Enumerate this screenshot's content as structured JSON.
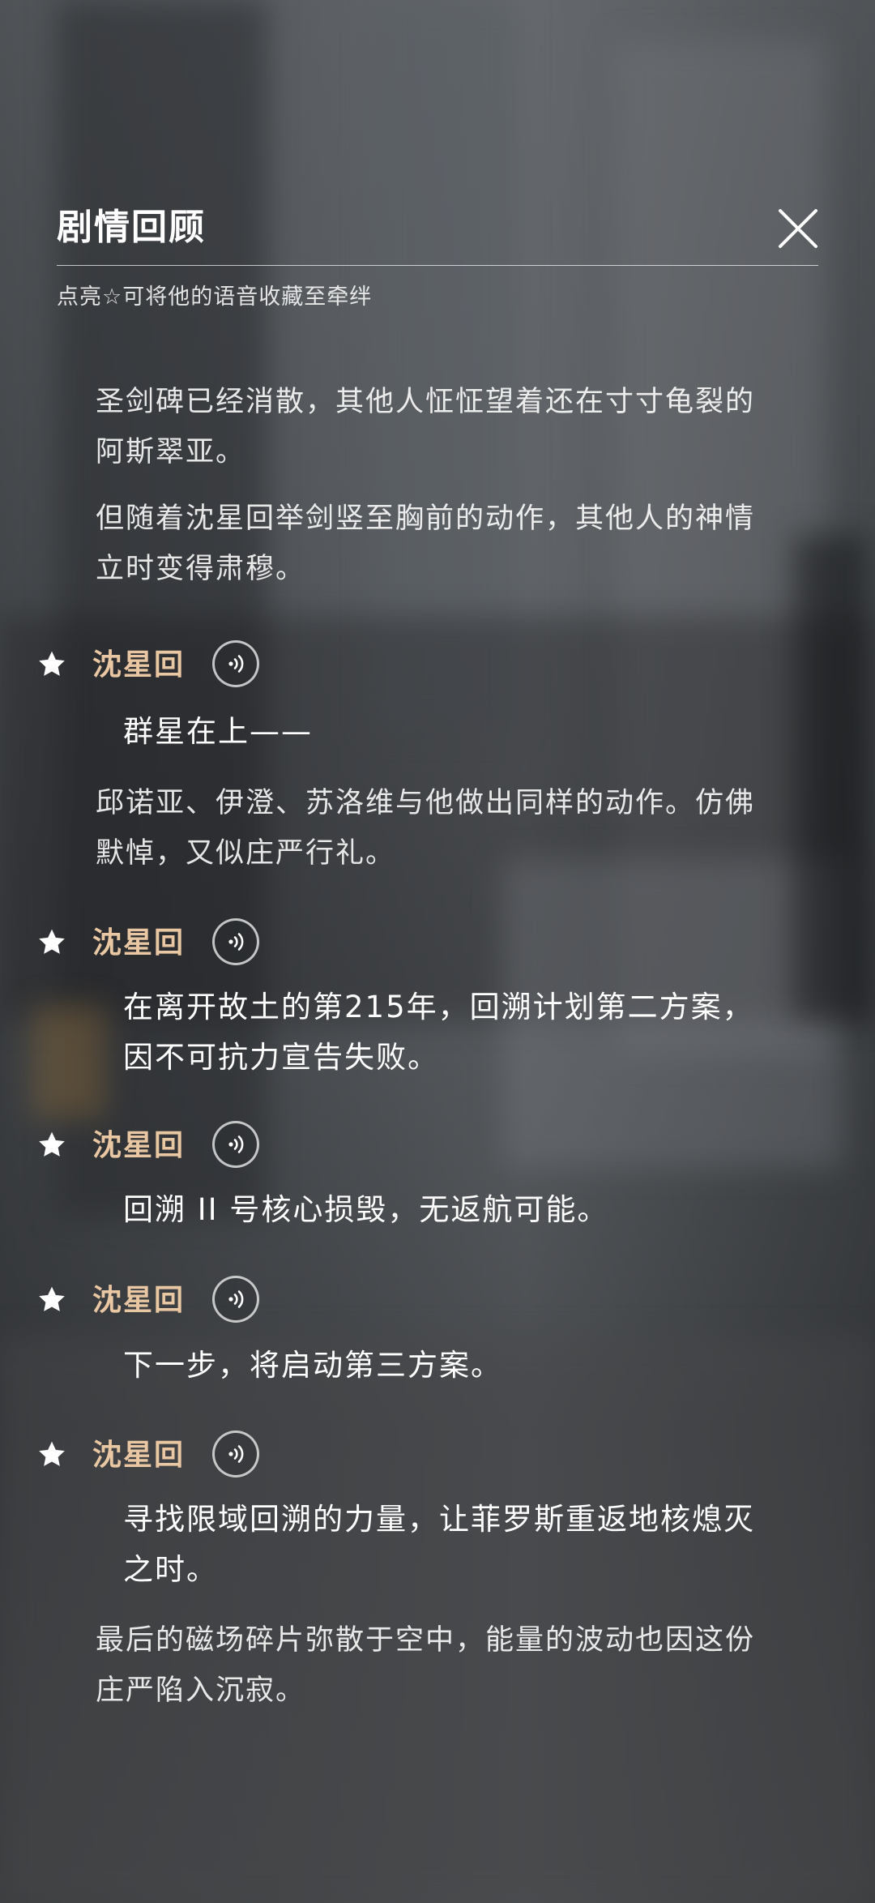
{
  "header": {
    "title": "剧情回顾",
    "hint": "点亮☆可将他的语音收藏至牵绊"
  },
  "paragraphs": [
    "圣剑碑已经消散，其他人怔怔望着还在寸寸龟裂的阿斯翠亚。",
    "但随着沈星回举剑竖至胸前的动作，其他人的神情立时变得肃穆。",
    "邱诺亚、伊澄、苏洛维与他做出同样的动作。仿佛默悼，又似庄严行礼。",
    "最后的磁场碎片弥散于空中，能量的波动也因这份庄严陷入沉寂。"
  ],
  "dialogues": [
    {
      "speaker": "沈星回",
      "text": "群星在上——"
    },
    {
      "speaker": "沈星回",
      "text": "在离开故土的第215年，回溯计划第二方案，因不可抗力宣告失败。"
    },
    {
      "speaker": "沈星回",
      "text": "回溯 II 号核心损毁，无返航可能。"
    },
    {
      "speaker": "沈星回",
      "text": "下一步，将启动第三方案。"
    },
    {
      "speaker": "沈星回",
      "text": "寻找限域回溯的力量，让菲罗斯重返地核熄灭之时。"
    }
  ],
  "icons": {
    "close": "close-icon",
    "favorite": "star-icon",
    "voice": "voice-play-icon"
  },
  "colors": {
    "speaker_name": "#e8c7a2",
    "text": "#ffffff"
  }
}
